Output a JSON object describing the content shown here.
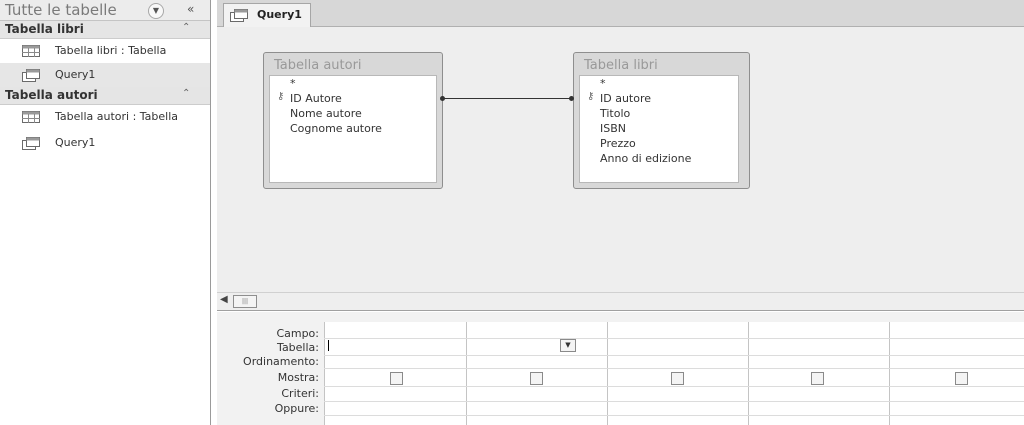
{
  "nav": {
    "title": "Tutte le tabelle",
    "groups": [
      {
        "label": "Tabella libri",
        "items": [
          {
            "label": "Tabella libri : Tabella",
            "icon": "table-icon"
          },
          {
            "label": "Query1",
            "icon": "query-icon",
            "selected": true
          }
        ]
      },
      {
        "label": "Tabella autori",
        "items": [
          {
            "label": "Tabella autori : Tabella",
            "icon": "table-icon"
          },
          {
            "label": "Query1",
            "icon": "query-icon"
          }
        ]
      }
    ]
  },
  "tab": {
    "label": "Query1",
    "icon": "query-icon"
  },
  "tables": [
    {
      "title": "Tabella autori",
      "fields": [
        "*",
        "ID Autore",
        "Nome autore",
        "Cognome autore"
      ],
      "key_field": "ID Autore"
    },
    {
      "title": "Tabella libri",
      "fields": [
        "*",
        "ID autore",
        "Titolo",
        "ISBN",
        "Prezzo",
        "Anno di edizione"
      ],
      "key_field": "ID autore"
    }
  ],
  "grid": {
    "rows": [
      "Campo:",
      "Tabella:",
      "Ordinamento:",
      "Mostra:",
      "Criteri:",
      "Oppure:"
    ],
    "column_count": 5,
    "mostra_checked": [
      false,
      false,
      false,
      false,
      false
    ]
  },
  "colors": {
    "accent": "#d7d7d7",
    "selection": "#e6e6e6"
  }
}
